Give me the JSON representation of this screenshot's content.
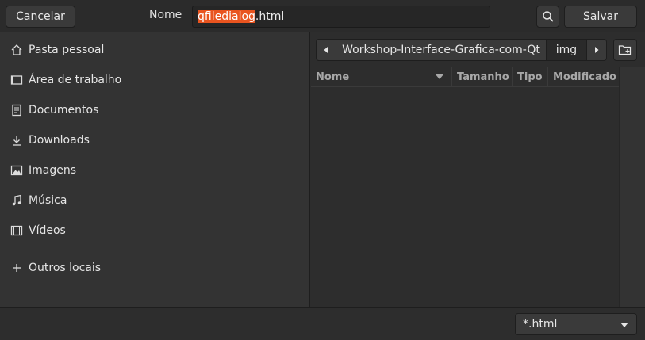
{
  "header": {
    "cancel_label": "Cancelar",
    "name_label": "Nome",
    "filename_selected": "qfiledialog",
    "filename_rest": ".html",
    "save_label": "Salvar"
  },
  "sidebar": {
    "items": [
      {
        "label": "Pasta pessoal",
        "icon": "home-icon"
      },
      {
        "label": "Área de trabalho",
        "icon": "desktop-icon"
      },
      {
        "label": "Documentos",
        "icon": "document-icon"
      },
      {
        "label": "Downloads",
        "icon": "download-icon"
      },
      {
        "label": "Imagens",
        "icon": "image-icon"
      },
      {
        "label": "Música",
        "icon": "music-icon"
      },
      {
        "label": "Vídeos",
        "icon": "video-icon"
      }
    ],
    "other_locations": {
      "label": "Outros locais",
      "icon": "plus-icon"
    }
  },
  "pathbar": {
    "crumbs": [
      "Workshop-Interface-Grafica-com-Qt",
      "img"
    ]
  },
  "filelist": {
    "columns": [
      "Nome",
      "Tamanho",
      "Tipo",
      "Modificado"
    ],
    "rows": []
  },
  "filter": {
    "selected": "*.html"
  },
  "colors": {
    "selection": "#e9541f",
    "background": "#2d2d2d",
    "sidebar": "#333333"
  }
}
